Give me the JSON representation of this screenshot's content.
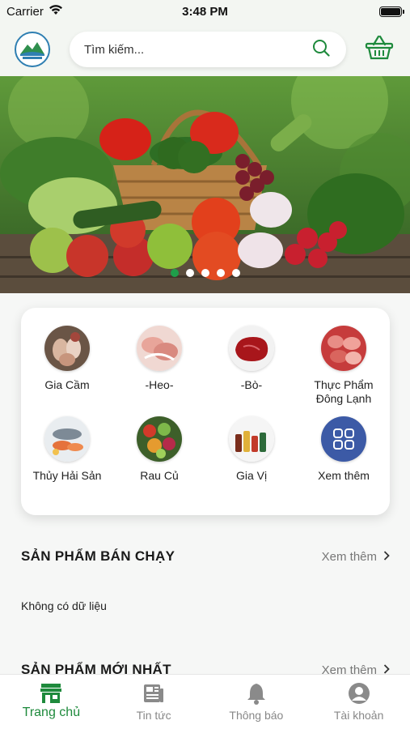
{
  "status_bar": {
    "carrier": "Carrier",
    "time": "3:48 PM"
  },
  "header": {
    "search_placeholder": "Tìm kiếm...",
    "accent": "#1e8a3c"
  },
  "banner": {
    "slide_count": 5,
    "active_slide": 1
  },
  "categories": [
    {
      "label": "Gia Cầm",
      "icon": "poultry-thumb"
    },
    {
      "label": "-Heo-",
      "icon": "pork-thumb"
    },
    {
      "label": "-Bò-",
      "icon": "beef-thumb"
    },
    {
      "label": "Thực Phẩm Đông Lạnh",
      "icon": "frozen-food-thumb"
    },
    {
      "label": "Thủy Hải Sản",
      "icon": "seafood-thumb"
    },
    {
      "label": "Rau Củ",
      "icon": "vegetables-thumb"
    },
    {
      "label": "Gia Vị",
      "icon": "spices-thumb"
    },
    {
      "label": "Xem thêm",
      "icon": "grid-icon"
    }
  ],
  "best_sellers": {
    "title": "SẢN PHẨM BÁN CHẠY",
    "see_more": "Xem thêm",
    "empty": "Không có dữ liệu"
  },
  "newest": {
    "title": "SẢN PHẨM MỚI NHẤT",
    "see_more": "Xem thêm"
  },
  "tabs": [
    {
      "label": "Trang chủ",
      "icon": "store-icon",
      "active": true
    },
    {
      "label": "Tin tức",
      "icon": "news-icon",
      "active": false
    },
    {
      "label": "Thông báo",
      "icon": "bell-icon",
      "active": false
    },
    {
      "label": "Tài khoản",
      "icon": "account-icon",
      "active": false
    }
  ]
}
